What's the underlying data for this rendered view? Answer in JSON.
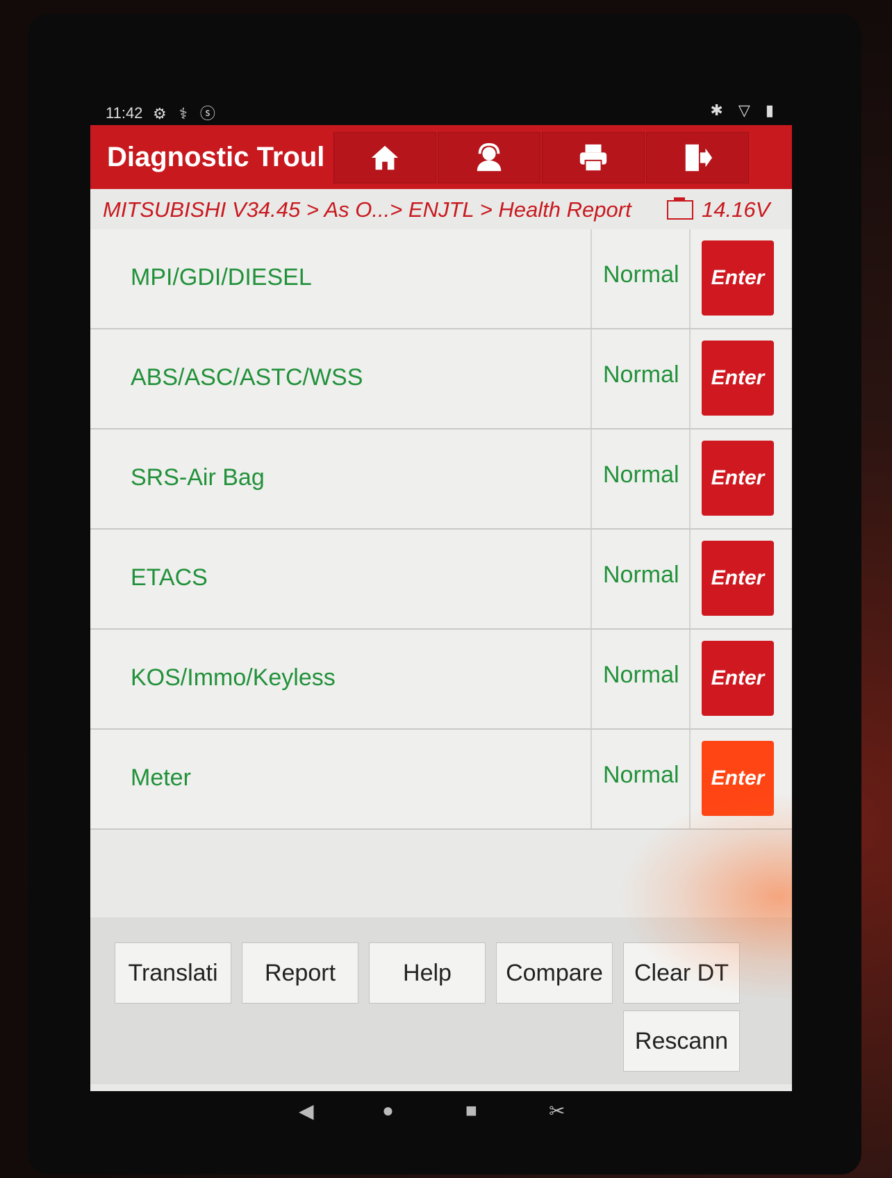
{
  "status_bar": {
    "time": "11:42",
    "left_icons": "⚙ ⚕ ⓢ",
    "right_icons": "✱ ▽ ▮"
  },
  "app_bar": {
    "title": "Diagnostic Troul",
    "toolbar": [
      {
        "name": "home-icon"
      },
      {
        "name": "support-agent-icon"
      },
      {
        "name": "print-icon"
      },
      {
        "name": "exit-icon"
      }
    ],
    "color": "#c8191f"
  },
  "breadcrumb": {
    "path": "MITSUBISHI V34.45 > As O...> ENJTL > Health Report",
    "voltage": "14.16V"
  },
  "systems": [
    {
      "name": "MPI/GDI/DIESEL",
      "status": "Normal",
      "button": "Enter"
    },
    {
      "name": "ABS/ASC/ASTC/WSS",
      "status": "Normal",
      "button": "Enter"
    },
    {
      "name": "SRS-Air Bag",
      "status": "Normal",
      "button": "Enter"
    },
    {
      "name": "ETACS",
      "status": "Normal",
      "button": "Enter"
    },
    {
      "name": "KOS/Immo/Keyless",
      "status": "Normal",
      "button": "Enter"
    },
    {
      "name": "Meter",
      "status": "Normal",
      "button": "Enter"
    }
  ],
  "actions": {
    "translate": "Translati",
    "report": "Report",
    "help": "Help",
    "compare": "Compare",
    "clear_dtc": "Clear DT",
    "rescan": "Rescann"
  },
  "nav": {
    "back": "◀",
    "home": "●",
    "recents": "■",
    "screenshot": "✂"
  },
  "colors": {
    "status_green": "#21913a",
    "enter_red": "#cf1820"
  }
}
